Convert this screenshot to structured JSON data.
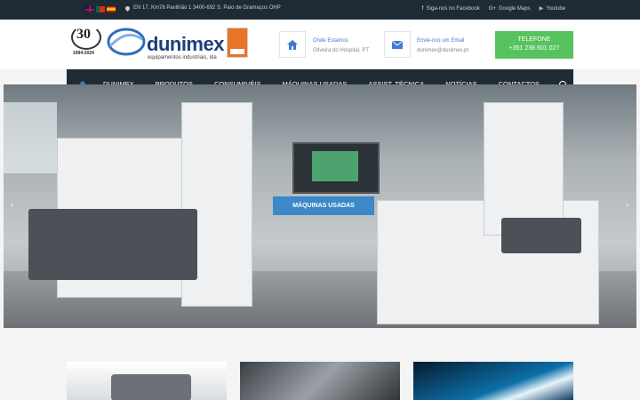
{
  "topbar": {
    "flags": [
      "uk-flag",
      "pt-flag",
      "es-flag"
    ],
    "address": "EN 17, Km78 Pavilhão 1 3400-692 S. Paio de Gramaços OHP",
    "social": [
      {
        "icon": "facebook-icon",
        "glyph": "f",
        "label": "Siga-nos no Facebook"
      },
      {
        "icon": "google-plus-icon",
        "glyph": "G+",
        "label": "Google Maps"
      },
      {
        "icon": "youtube-icon",
        "glyph": "▶",
        "label": "Youtube"
      }
    ]
  },
  "header": {
    "badge_number": "30",
    "badge_years": "1994-2024",
    "logo_text": "dunimex",
    "logo_sub": "equipamentos industriais, lda",
    "location_label": "Onde Estamos",
    "location_value": "Oliveira do Hospital, PT",
    "email_label": "Envie-nos um Email",
    "email_value": "dunimex@dunimex.pt",
    "phone_label": "TELEFONE",
    "phone_value": "+351 238 601 027"
  },
  "nav": {
    "items": [
      "DUNIMEX",
      "PRODUTOS",
      "CONSUMIVÉIS",
      "MÁQUINAS USADAS",
      "ASSIST. TÉCNICA",
      "NOTÍCIAS",
      "CONTACTOS"
    ]
  },
  "slider": {
    "button_label": "MÁQUINAS USADAS",
    "prev_arrow": "‹",
    "next_arrow": "›"
  },
  "colors": {
    "dark_bar": "#1f2a33",
    "accent_blue": "#3c7bd0",
    "phone_green": "#57c35f",
    "slider_button": "#3c88c9"
  }
}
